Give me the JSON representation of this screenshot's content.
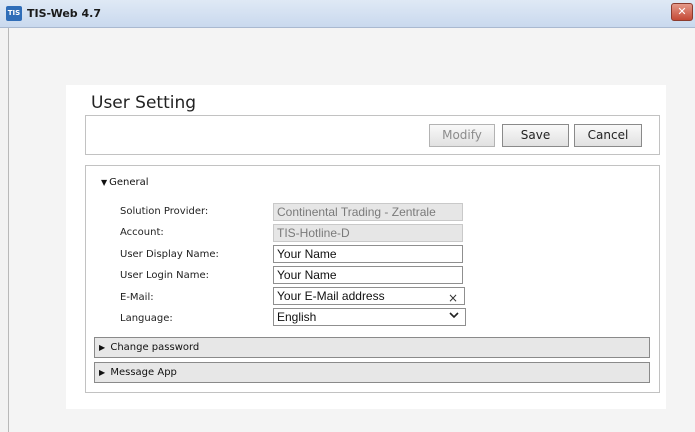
{
  "window": {
    "app_icon_text": "TIS",
    "title": "TIS-Web 4.7",
    "close_glyph": "✕"
  },
  "page": {
    "title": "User Setting"
  },
  "toolbar": {
    "modify_label": "Modify",
    "save_label": "Save",
    "cancel_label": "Cancel"
  },
  "general": {
    "header": "General",
    "fields": {
      "solution_provider": {
        "label": "Solution Provider:",
        "value": "Continental Trading - Zentrale"
      },
      "account": {
        "label": "Account:",
        "value": "TIS-Hotline-D"
      },
      "display_name": {
        "label": "User Display Name:",
        "value": "Your Name"
      },
      "login_name": {
        "label": "User Login Name:",
        "value": "Your Name"
      },
      "email": {
        "label": "E-Mail:",
        "value": "Your E-Mail address",
        "clear_glyph": "×"
      },
      "language": {
        "label": "Language:",
        "value": "English"
      }
    }
  },
  "sections": {
    "change_password": "Change password",
    "message_app": "Message App"
  },
  "icons": {
    "expanded": "triangle-down-icon",
    "collapsed": "triangle-right-icon",
    "dropdown": "chevron-down-icon"
  }
}
